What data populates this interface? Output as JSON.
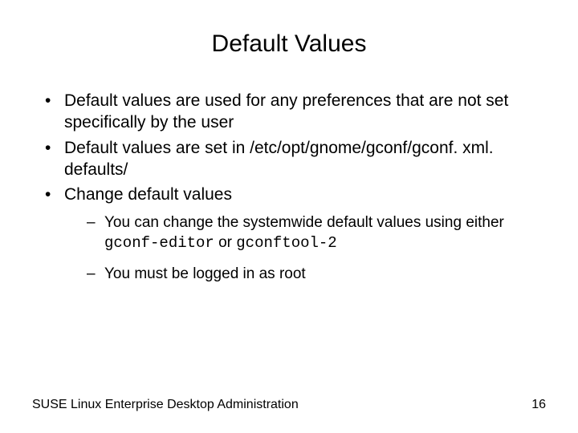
{
  "title": "Default Values",
  "bullets": {
    "b1": "Default values are used for any preferences that are not set specifically by the user",
    "b2_pre": "Default values are set in ",
    "b2_path": "/etc/opt/gnome/gconf/gconf. xml. defaults/",
    "b3": "Change default values",
    "sub1_pre": "You can change the systemwide default values using either ",
    "sub1_code1": "gconf-editor",
    "sub1_mid": " or ",
    "sub1_code2": "gconftool-2",
    "sub2": "You must be logged in as root"
  },
  "footer": {
    "left": "SUSE Linux Enterprise Desktop Administration",
    "right": "16"
  }
}
